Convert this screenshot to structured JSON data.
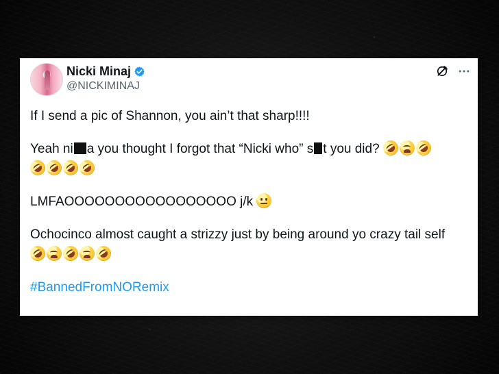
{
  "tweet": {
    "display_name": "Nicki Minaj",
    "handle": "@NICKIMINAJ",
    "verified_icon": "verified-badge-icon",
    "actions": {
      "grok_icon": "grok-icon",
      "more_icon": "more-icon"
    },
    "line_1": "If I send a pic of Shannon, you ain’t that sharp!!!!",
    "line_2_part_1": "Yeah ni",
    "line_2_part_2": "a you thought I forgot that “Nicki who” s",
    "line_2_part_3": "t you did?",
    "line_3_text": "LMFAOOOOOOOOOOOOOOOOO j/k",
    "line_4": "Ochocinco almost caught a strizzy just by being around yo crazy tail self",
    "hashtag": "#BannedFromNORemix",
    "emojis": {
      "line_2_inline": [
        "rolling-on-floor-laughing",
        "weary-face",
        "rolling-on-floor-laughing"
      ],
      "line_2_next": [
        "rolling-on-floor-laughing",
        "rolling-on-floor-laughing",
        "rolling-on-floor-laughing",
        "rolling-on-floor-laughing"
      ],
      "line_3": [
        "neutral-face"
      ],
      "line_4": [
        "rolling-on-floor-laughing",
        "weary-face",
        "rolling-on-floor-laughing",
        "weary-face",
        "rolling-on-floor-laughing"
      ]
    }
  },
  "colors": {
    "background": "#0b0b0b",
    "card": "#ffffff",
    "text": "#0f1419",
    "secondary_text": "#536471",
    "link": "#1d9bf0",
    "verified": "#1d9bf0"
  }
}
